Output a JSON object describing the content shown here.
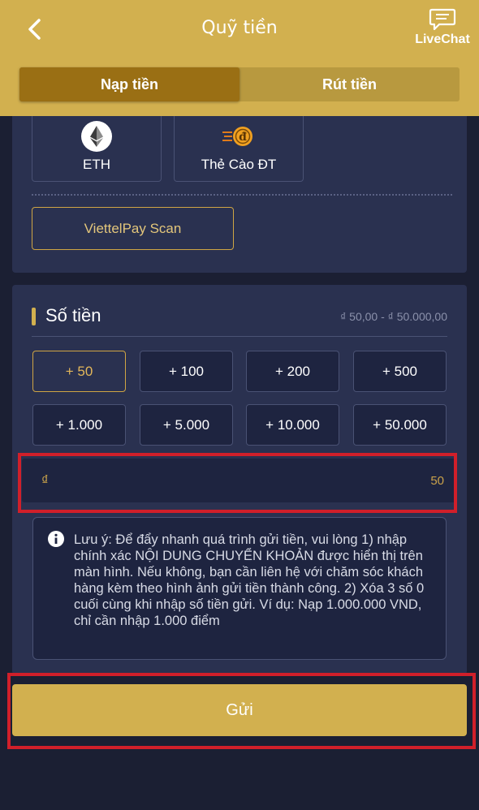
{
  "header": {
    "title": "Quỹ tiền",
    "livechat_label": "LiveChat",
    "tabs": [
      {
        "label": "Nạp tiền",
        "active": true
      },
      {
        "label": "Rút tiền",
        "active": false
      }
    ]
  },
  "methods": {
    "cards": [
      {
        "label": "ETH",
        "icon": "ethereum-icon"
      },
      {
        "label": "Thẻ Cào ĐT",
        "icon": "phone-card-icon"
      }
    ],
    "viettel_label": "ViettelPay Scan"
  },
  "amount": {
    "title": "Số tiền",
    "range": "₫ 50,00 - ₫ 50.000,00",
    "presets": [
      "+ 50",
      "+ 100",
      "+ 200",
      "+ 500",
      "+ 1.000",
      "+ 5.000",
      "+ 10.000",
      "+ 50.000"
    ],
    "selected_preset": "+ 50",
    "currency_symbol": "₫",
    "value": "50",
    "note": "Lưu ý: Để đẩy nhanh quá trình gửi tiền, vui lòng 1) nhập chính xác NỘI DUNG CHUYỂN KHOẢN được hiển thị trên màn hình. Nếu không, bạn cần liên hệ với chăm sóc khách hàng kèm theo hình ảnh gửi tiền thành công. 2) Xóa 3 số 0 cuối cùng khi nhập số tiền gửi. Ví dụ: Nạp 1.000.000 VND, chỉ cần nhập 1.000 điểm"
  },
  "submit_label": "Gửi",
  "colors": {
    "header": "#d2b04f",
    "accent": "#cfa544",
    "panel": "#2a3150",
    "background": "#1b1f33",
    "highlight": "#d11f2a"
  }
}
